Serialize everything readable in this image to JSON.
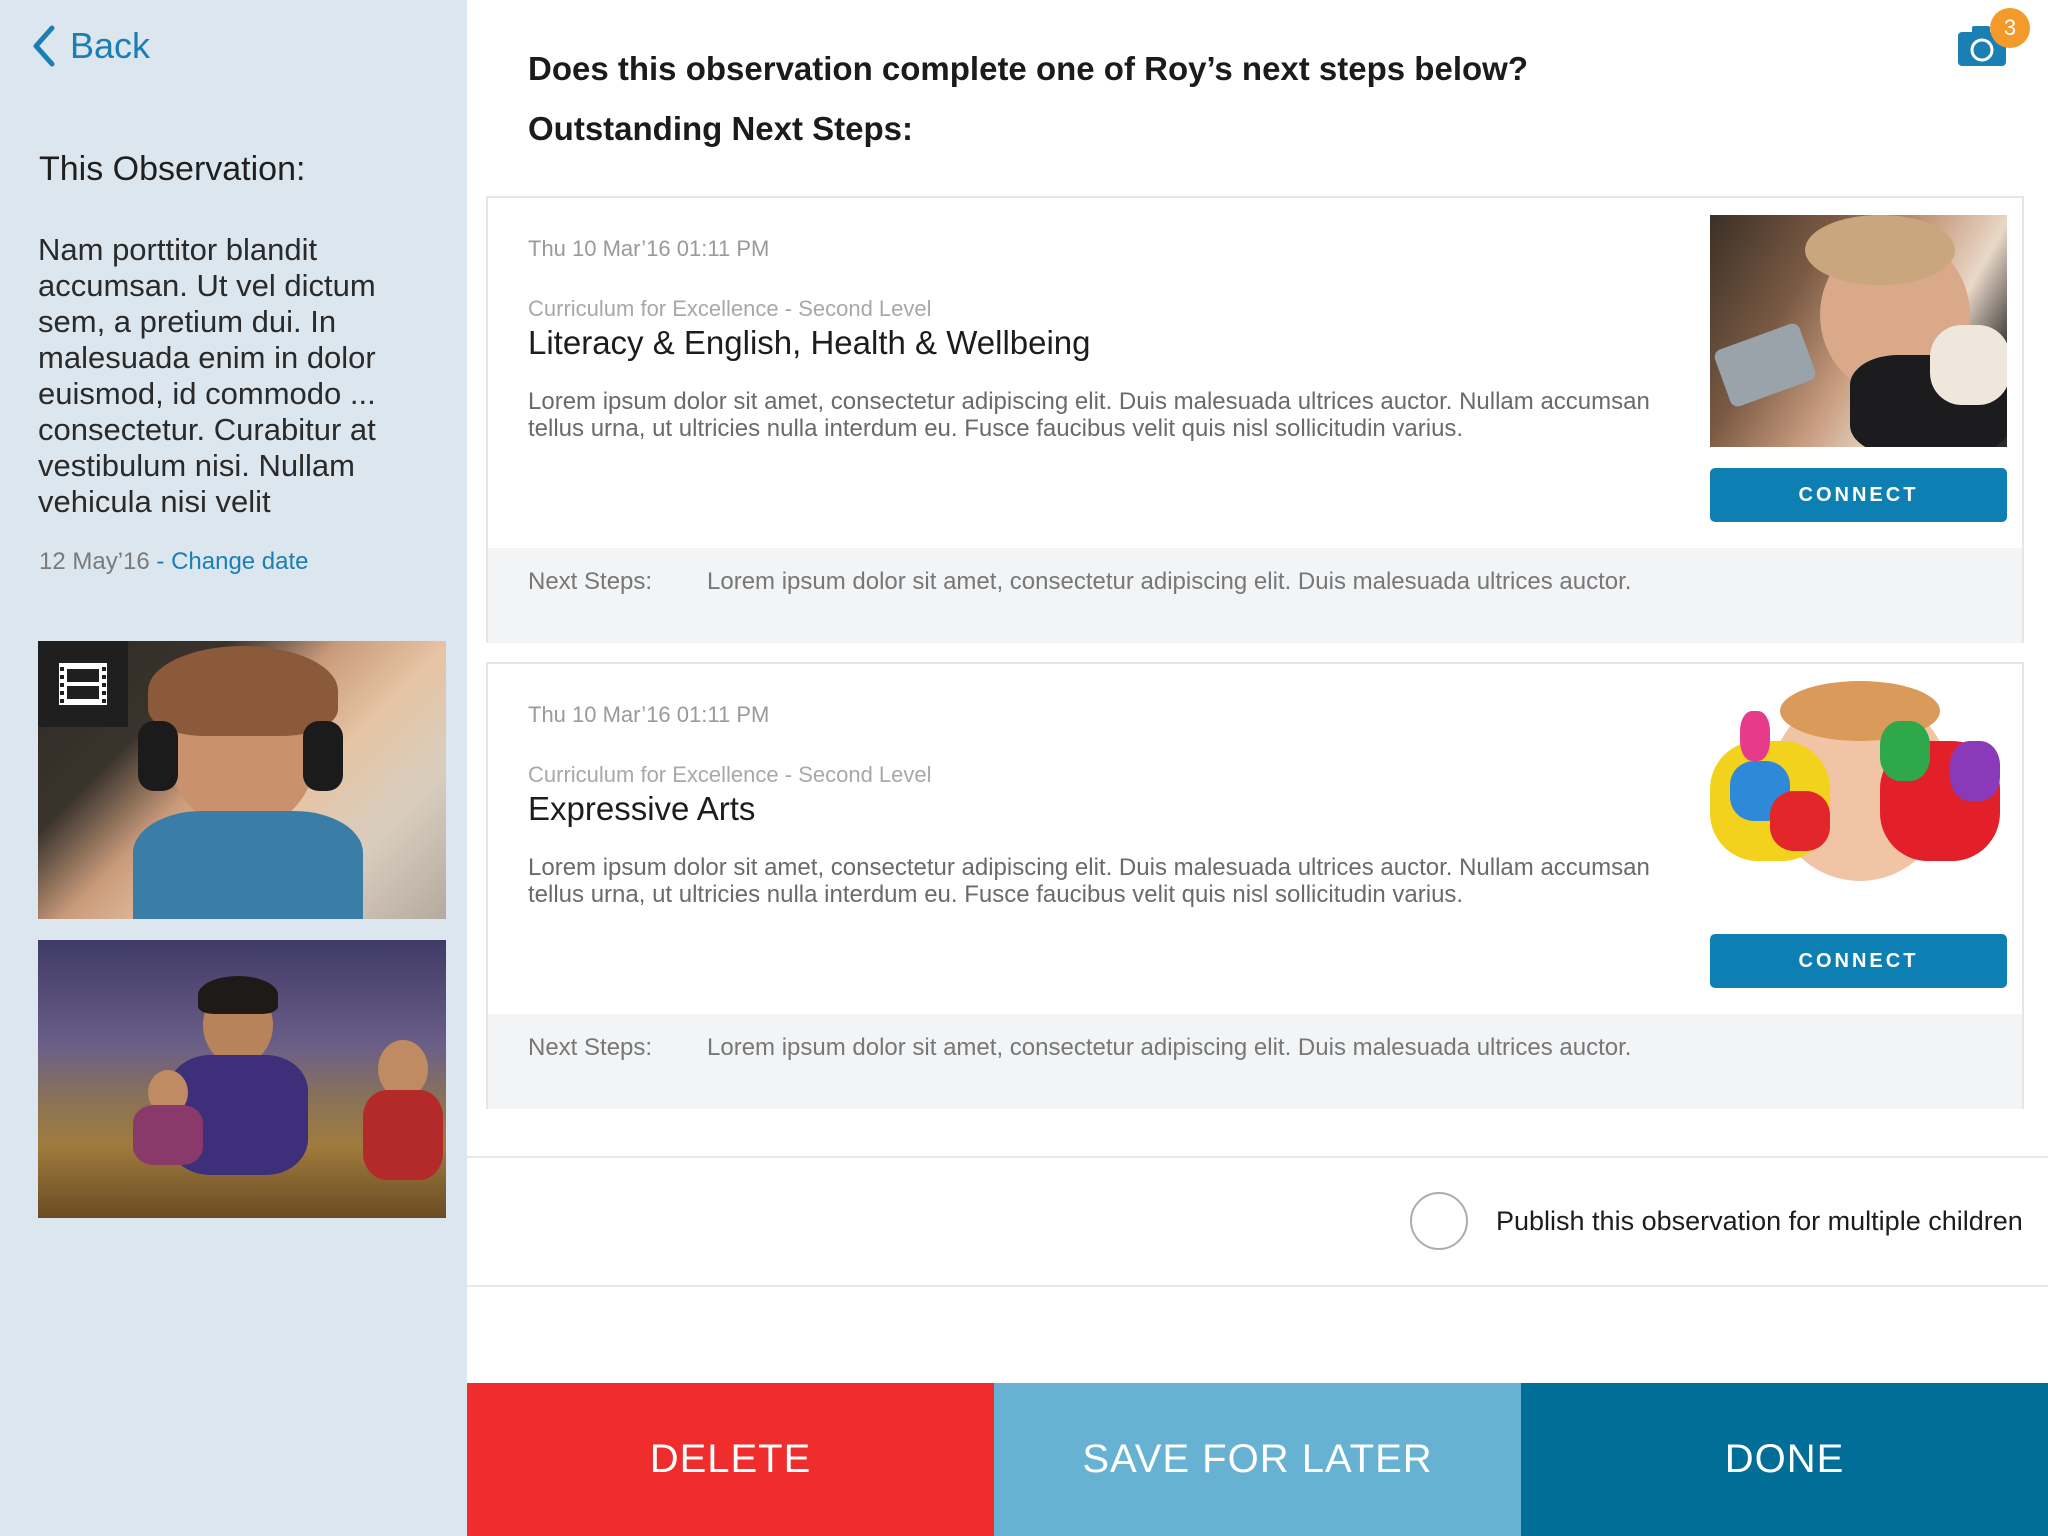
{
  "sidebar": {
    "back_label": "Back",
    "observation_heading": "This Observation:",
    "observation_text": "Nam porttitor blandit accumsan. Ut vel dictum sem, a pretium dui. In malesuada enim in dolor euismod, id commodo ... consectetur. Curabitur at vestibulum nisi. Nullam vehicula nisi velit",
    "date": "12 May’16",
    "change_date_separator": " - ",
    "change_date_label": "Change date",
    "media": [
      {
        "type": "video",
        "icon": "film-icon"
      },
      {
        "type": "photo"
      }
    ]
  },
  "main": {
    "question": "Does this observation complete one of Roy’s next steps below?",
    "subheading": "Outstanding Next Steps:",
    "camera": {
      "icon": "camera-icon",
      "badge_count": "3"
    },
    "cards": [
      {
        "timestamp": "Thu 10 Mar’16 01:11 PM",
        "curriculum": "Curriculum for Excellence - Second Level",
        "title": "Literacy & English, Health & Wellbeing",
        "description": "Lorem ipsum dolor sit amet, consectetur adipiscing elit. Duis malesuada ultrices auctor. Nullam accumsan tellus urna, ut ultricies nulla interdum eu. Fusce faucibus velit quis nisl sollicitudin varius.",
        "connect_label": "CONNECT",
        "next_steps_label": "Next Steps:",
        "next_steps_text": "Lorem ipsum dolor sit amet, consectetur adipiscing elit. Duis malesuada ultrices auctor."
      },
      {
        "timestamp": "Thu 10 Mar’16 01:11 PM",
        "curriculum": "Curriculum for Excellence - Second Level",
        "title": "Expressive Arts",
        "description": "Lorem ipsum dolor sit amet, consectetur adipiscing elit. Duis malesuada ultrices auctor. Nullam accumsan tellus urna, ut ultricies nulla interdum eu. Fusce faucibus velit quis nisl sollicitudin varius.",
        "connect_label": "CONNECT",
        "next_steps_label": "Next Steps:",
        "next_steps_text": "Lorem ipsum dolor sit amet, consectetur adipiscing elit. Duis malesuada ultrices auctor."
      }
    ],
    "publish_label": "Publish this observation for multiple children",
    "publish_checked": false
  },
  "actions": {
    "delete_label": "DELETE",
    "save_label": "SAVE FOR LATER",
    "done_label": "DONE"
  },
  "colors": {
    "sidebar_bg": "#dce6ee",
    "accent": "#1a80b4",
    "connect": "#0e7fb2",
    "delete": "#ee2d2c",
    "save": "#67b2d3",
    "done": "#016e98",
    "badge": "#f39a2a"
  }
}
